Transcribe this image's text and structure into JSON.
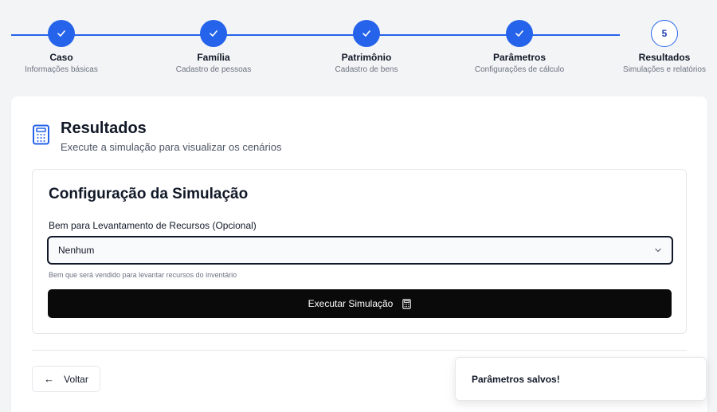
{
  "stepper": {
    "steps": [
      {
        "title": "Caso",
        "subtitle": "Informações básicas",
        "state": "done",
        "icon": "check-icon"
      },
      {
        "title": "Família",
        "subtitle": "Cadastro de pessoas",
        "state": "done",
        "icon": "check-icon"
      },
      {
        "title": "Patrimônio",
        "subtitle": "Cadastro de bens",
        "state": "done",
        "icon": "check-icon"
      },
      {
        "title": "Parâmetros",
        "subtitle": "Configurações de cálculo",
        "state": "done",
        "icon": "check-icon"
      },
      {
        "title": "Resultados",
        "subtitle": "Simulações e relatórios",
        "state": "current",
        "number": "5"
      }
    ]
  },
  "card": {
    "title": "Resultados",
    "subtitle": "Execute a simulação para visualizar os cenários",
    "icon": "calculator-icon"
  },
  "simulation": {
    "title": "Configuração da Simulação",
    "field_label": "Bem para Levantamento de Recursos (Opcional)",
    "selected_value": "Nenhum",
    "hint": "Bem que será vendido para levantar recursos do inventário",
    "run_label": "Executar Simulação"
  },
  "footer": {
    "back_label": "Voltar",
    "back_arrow": "←"
  },
  "toast": {
    "message": "Parâmetros salvos!"
  },
  "colors": {
    "accent": "#2563eb",
    "primary_button": "#0a0a0a",
    "background": "#f3f4f6"
  }
}
